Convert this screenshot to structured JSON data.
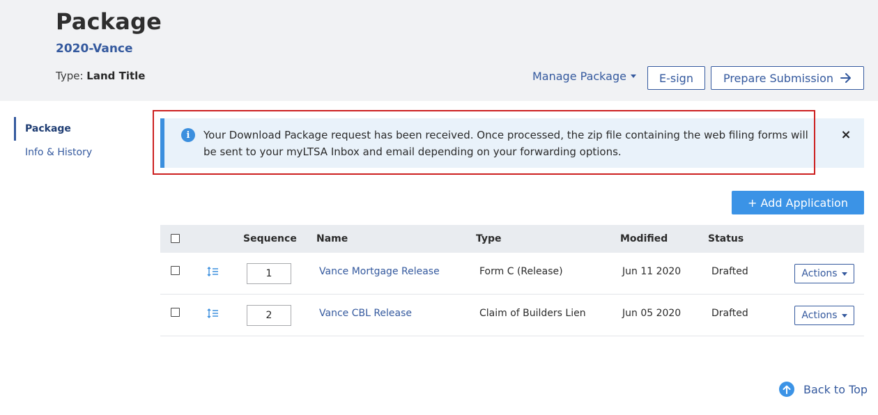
{
  "header": {
    "title": "Package",
    "package_name": "2020-Vance",
    "type_label": "Type:",
    "type_value": "Land Title",
    "manage_label": "Manage Package",
    "esign_label": "E-sign",
    "prepare_label": "Prepare Submission"
  },
  "sidenav": {
    "items": [
      {
        "label": "Package",
        "active": true
      },
      {
        "label": "Info & History",
        "active": false
      }
    ]
  },
  "alert": {
    "icon": "info-icon",
    "message": "Your Download Package request has been received. Once processed, the zip file containing the web filing forms will be sent to your myLTSA Inbox and email depending on your forwarding options.",
    "close_glyph": "×"
  },
  "toolbar": {
    "add_application_label": "+ Add Application"
  },
  "table": {
    "headers": {
      "sequence": "Sequence",
      "name": "Name",
      "type": "Type",
      "modified": "Modified",
      "status": "Status"
    },
    "rows": [
      {
        "sequence": "1",
        "name": "Vance Mortgage Release",
        "type": "Form C (Release)",
        "modified": "Jun 11 2020",
        "status": "Drafted",
        "actions_label": "Actions"
      },
      {
        "sequence": "2",
        "name": "Vance CBL Release",
        "type": "Claim of Builders Lien",
        "modified": "Jun 05 2020",
        "status": "Drafted",
        "actions_label": "Actions"
      }
    ]
  },
  "footer": {
    "back_to_top_label": "Back to Top"
  },
  "colors": {
    "primary": "#34599e",
    "accent": "#3b93e6",
    "alert_bg": "#e9f2fa",
    "highlight": "#cc1f1f",
    "header_bg": "#f1f2f4"
  }
}
